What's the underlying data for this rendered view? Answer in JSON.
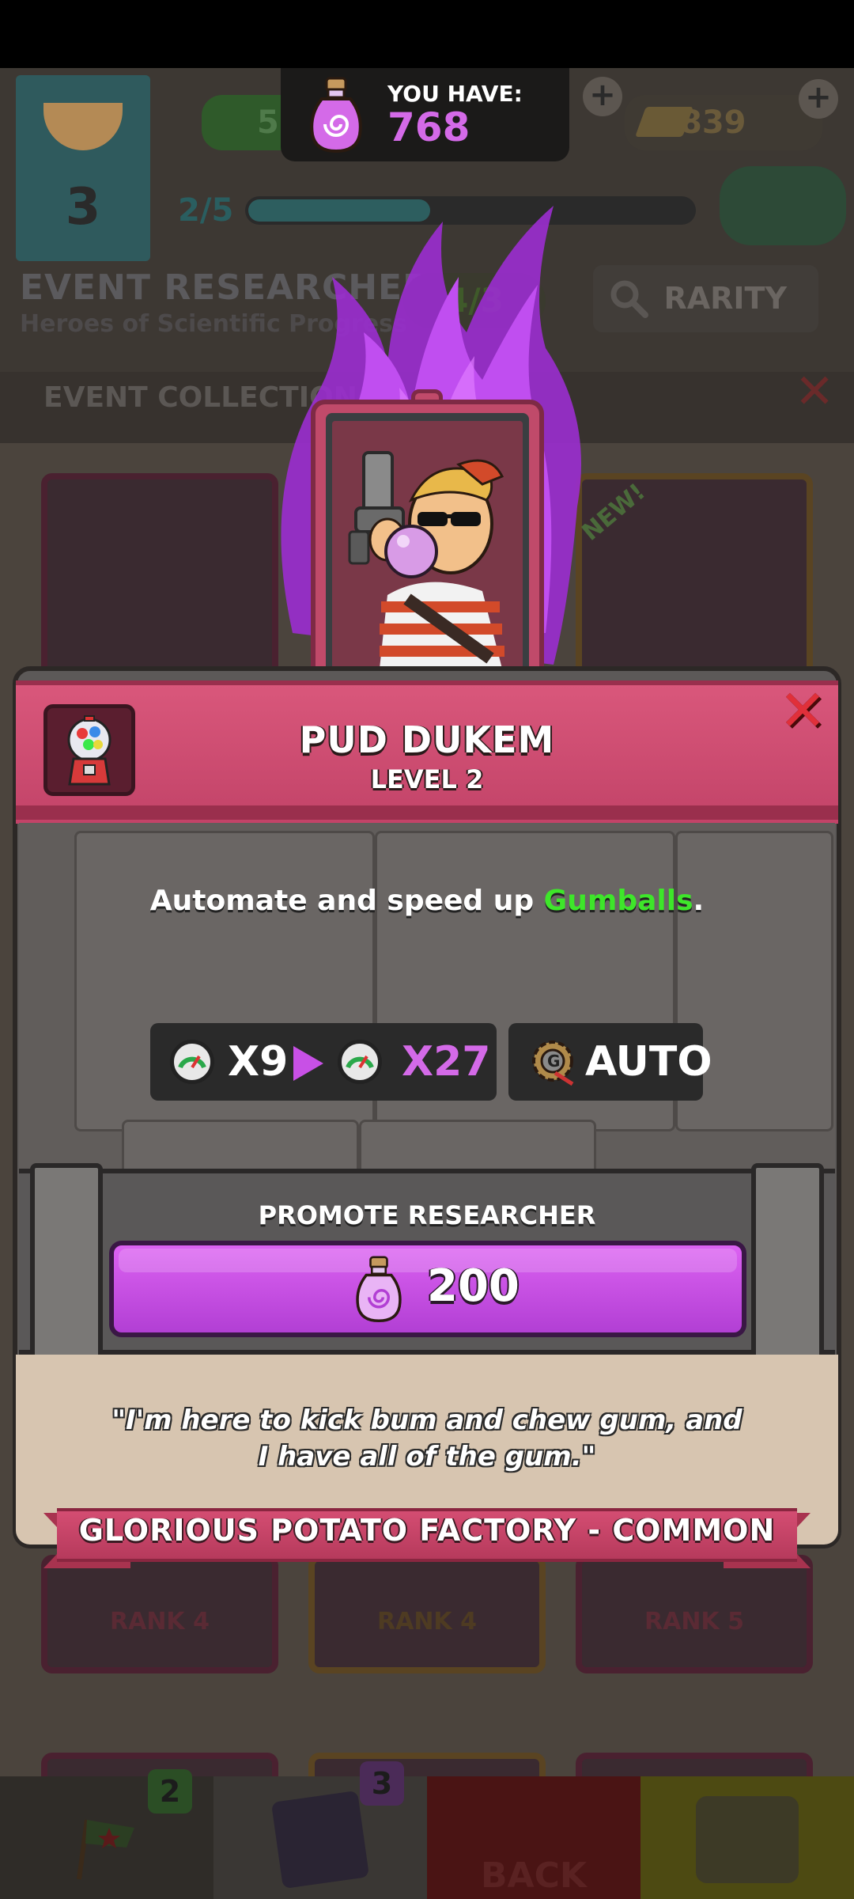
{
  "header": {
    "currency_label": "YOU HAVE:",
    "currency_value": "768",
    "bg_green_value": "52",
    "bg_gold_value": "839",
    "bg_banner_number": "3",
    "bg_progress": "2/5"
  },
  "background": {
    "collection_title": "EVENT RESEARCHERS",
    "collection_subtitle": "Heroes of Scientific Progress",
    "collection_count": "4/3",
    "rarity_button": "RARITY",
    "section_label": "EVENT COLLECTION",
    "new_badge": "NEW!",
    "ranks": [
      "RANK 4",
      "RANK 4",
      "RANK 5"
    ],
    "nav_badges": [
      "2",
      "3"
    ],
    "back_label": "BACK"
  },
  "researcher": {
    "name": "PUD DUKEM",
    "level": "LEVEL 2",
    "description_prefix": "Automate and speed up ",
    "description_highlight": "Gumballs",
    "description_suffix": ".",
    "current_multiplier": "X9",
    "next_multiplier": "X27",
    "ability": "AUTO",
    "promote_label": "PROMOTE RESEARCHER",
    "promote_cost": "200",
    "quote": "\"I'm here to kick bum and chew gum, and I have all of the gum.\"",
    "origin": "GLORIOUS POTATO FACTORY - COMMON"
  },
  "colors": {
    "accent_purple": "#d46ae8",
    "highlight_green": "#3ee62a",
    "close_red": "#e0303a",
    "ribbon_pink": "#c8456a"
  },
  "icons": [
    "potion-icon",
    "gumball-machine-icon",
    "speed-gauge-icon",
    "gear-auto-icon",
    "close-icon",
    "plus-icon",
    "search-icon"
  ]
}
